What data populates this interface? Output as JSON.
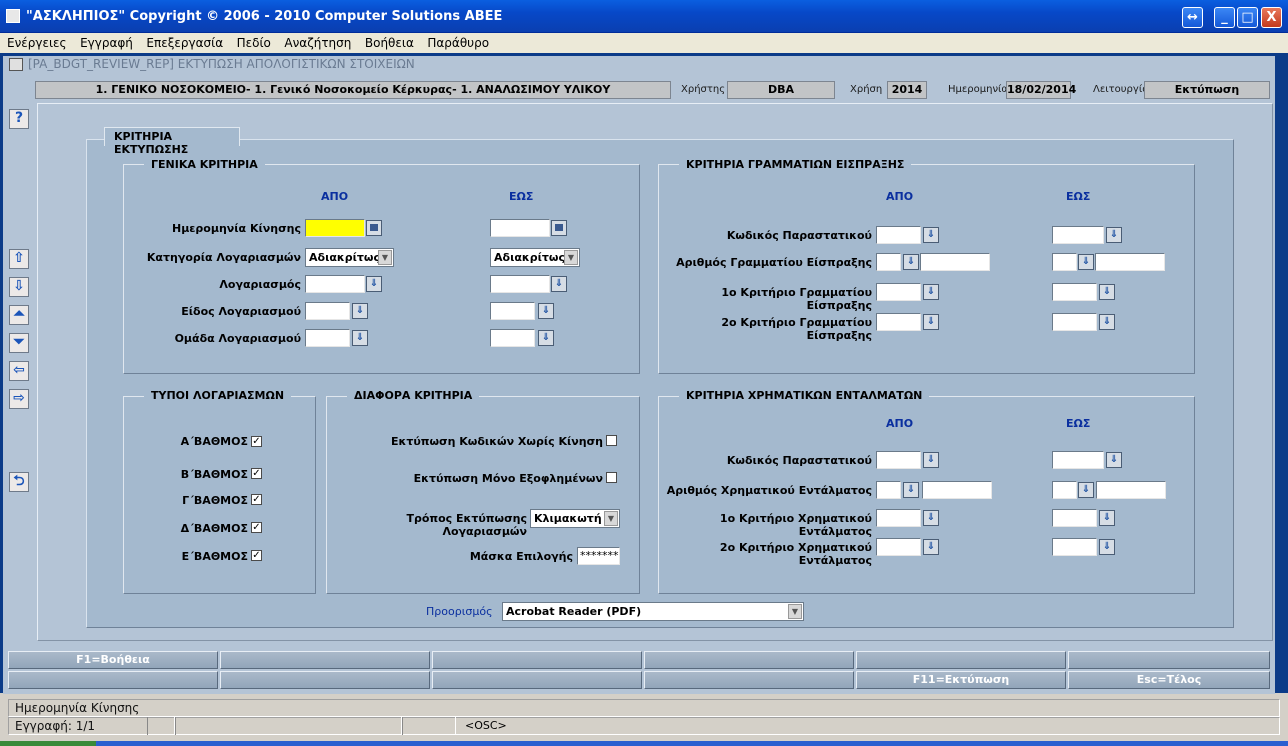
{
  "window": {
    "title": "\"ΑΣΚΛΗΠΙΟΣ\" Copyright © 2006 - 2010 Computer Solutions ABEE",
    "restore_icon": "resize-icon",
    "minimize": "_",
    "maximize": "□",
    "close": "X"
  },
  "menu": [
    "Ενέργειες",
    "Εγγραφή",
    "Επεξεργασία",
    "Πεδίο",
    "Αναζήτηση",
    "Βοήθεια",
    "Παράθυρο"
  ],
  "form_title": "[PA_BDGT_REVIEW_REP]   ΕΚΤΥΠΩΣΗ ΑΠΟΛΟΓΙΣΤΙΚΩΝ ΣΤΟΙΧΕΙΩΝ",
  "header": {
    "hospital": "1. ΓΕΝΙΚΟ ΝΟΣΟΚΟΜΕΙΟ- 1. Γενικό Νοσοκομείο Κέρκυρας- 1. ΑΝΑΛΩΣΙΜΟΥ ΥΛΙΚΟΥ",
    "user_label": "Χρήστης",
    "user": "DBA",
    "year_label": "Χρήση",
    "year": "2014",
    "date_label": "Ημερομηνία",
    "date": "18/02/2014",
    "function_label": "Λειτουργία",
    "function": "Εκτύπωση"
  },
  "side": {
    "help": "?",
    "first": "⇧",
    "last": "⇩",
    "prev": "⏶",
    "next": "⏷",
    "left": "⇦",
    "right": "⇨",
    "back": "⮌"
  },
  "panel_tab": "ΚΡΙΤΗΡΙΑ ΕΚΤΥΠΩΣΗΣ",
  "general": {
    "title": "ΓΕΝΙΚΑ ΚΡΙΤΗΡΙΑ",
    "from": "ΑΠΟ",
    "to": "ΕΩΣ",
    "rows": [
      "Ημερομηνία Κίνησης",
      "Κατηγορία Λογαριασμών",
      "Λογαριασμός",
      "Είδος Λογαριασμού",
      "Ομάδα Λογαριασμού"
    ],
    "category_from": "Αδιακρίτως",
    "category_to": "Αδιακρίτως"
  },
  "receipts": {
    "title": "ΚΡΙΤΗΡΙΑ ΓΡΑΜΜΑΤΙΩΝ ΕΙΣΠΡΑΞΗΣ",
    "from": "ΑΠΟ",
    "to": "ΕΩΣ",
    "rows": [
      "Κωδικός Παραστατικού",
      "Αριθμός Γραμματίου Είσπραξης",
      "1ο Κριτήριο Γραμματίου Είσπραξης",
      "2ο Κριτήριο Γραμματίου Είσπραξης"
    ]
  },
  "types": {
    "title": "ΤΥΠΟΙ ΛΟΓΑΡΙΑΣΜΩΝ",
    "items": [
      "Α΄ΒΑΘΜΟΣ",
      "Β΄ΒΑΘΜΟΣ",
      "Γ΄ΒΑΘΜΟΣ",
      "Δ΄ΒΑΘΜΟΣ",
      "Ε΄ΒΑΘΜΟΣ"
    ],
    "checkmark": "✓"
  },
  "misc": {
    "title": "ΔΙΑΦΟΡΑ ΚΡΙΤΗΡΙΑ",
    "no_movement": "Εκτύπωση Κωδικών Χωρίς Κίνηση",
    "paid_only": "Εκτύπωση Μόνο Εξοφλημένων",
    "print_mode_label": "Τρόπος Εκτύπωσης Λογαριασμών",
    "print_mode": "Κλιμακωτή",
    "mask_label": "Μάσκα Επιλογής",
    "mask": "*******"
  },
  "payments": {
    "title": "ΚΡΙΤΗΡΙΑ ΧΡΗΜΑΤΙΚΩΝ ΕΝΤΑΛΜΑΤΩΝ",
    "from": "ΑΠΟ",
    "to": "ΕΩΣ",
    "rows": [
      "Κωδικός Παραστατικού",
      "Αριθμός Χρηματικού Εντάλματος",
      "1ο Κριτήριο Χρηματικού Εντάλματος",
      "2ο Κριτήριο Χρηματικού Εντάλματος"
    ]
  },
  "destination": {
    "label": "Προορισμός",
    "value": "Acrobat Reader (PDF)"
  },
  "fkeys": {
    "f1": "F1=Βοήθεια",
    "f11": "F11=Εκτύπωση",
    "esc": "Esc=Τέλος"
  },
  "status": {
    "field": "Ημερομηνία Κίνησης",
    "record": "Εγγραφή: 1/1",
    "osc": "<OSC>"
  },
  "colors": {
    "title_bar": "#0a4fd0",
    "form_bg": "#b4c4d6",
    "panel": "#a4b9ce",
    "header_blue": "#0a2f9f",
    "highlight": "#ffff00"
  }
}
